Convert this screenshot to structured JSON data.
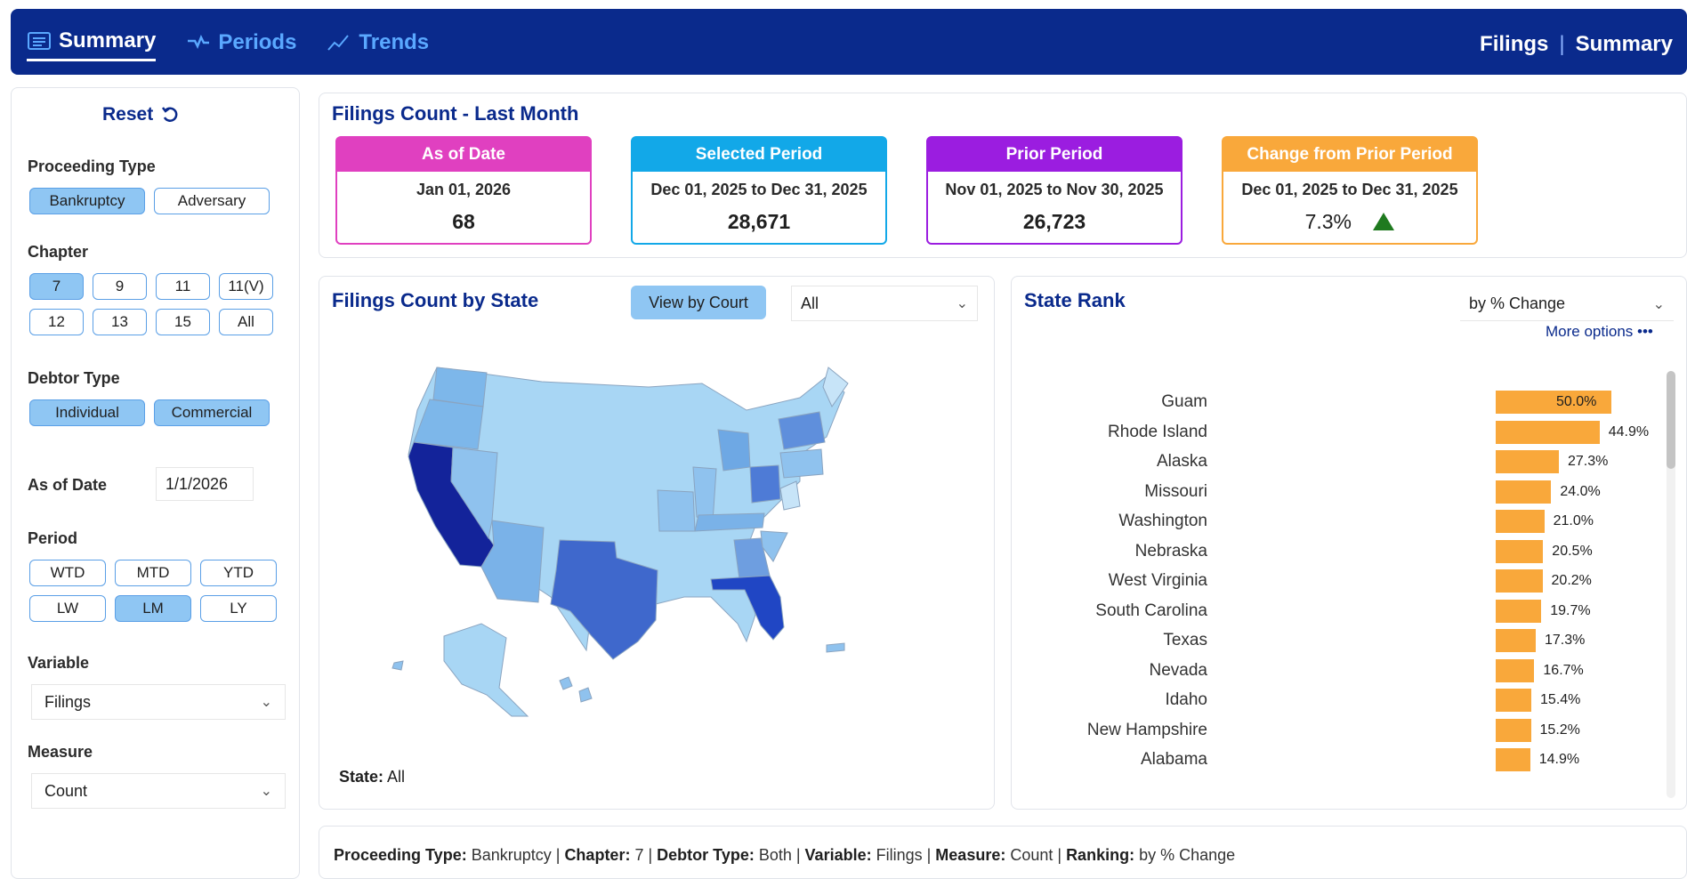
{
  "nav": {
    "tabs": [
      {
        "label": "Summary",
        "icon": "list-icon",
        "active": true
      },
      {
        "label": "Periods",
        "icon": "step-chart-icon",
        "active": false
      },
      {
        "label": "Trends",
        "icon": "trend-line-icon",
        "active": false
      }
    ],
    "breadcrumb": {
      "first": "Filings",
      "separator": "|",
      "second": "Summary"
    }
  },
  "filters": {
    "reset_label": "Reset",
    "proceeding_type": {
      "label": "Proceeding Type",
      "options": [
        "Bankruptcy",
        "Adversary"
      ],
      "selected": [
        "Bankruptcy"
      ]
    },
    "chapter": {
      "label": "Chapter",
      "options": [
        "7",
        "9",
        "11",
        "11(V)",
        "12",
        "13",
        "15",
        "All"
      ],
      "selected": [
        "7"
      ]
    },
    "debtor_type": {
      "label": "Debtor Type",
      "options": [
        "Individual",
        "Commercial"
      ],
      "selected": [
        "Individual",
        "Commercial"
      ]
    },
    "as_of_date": {
      "label": "As of Date",
      "value": "1/1/2026"
    },
    "period": {
      "label": "Period",
      "options": [
        "WTD",
        "MTD",
        "YTD",
        "LW",
        "LM",
        "LY"
      ],
      "selected": [
        "LM"
      ]
    },
    "variable": {
      "label": "Variable",
      "value": "Filings"
    },
    "measure": {
      "label": "Measure",
      "value": "Count"
    }
  },
  "kpi": {
    "title": "Filings Count - Last Month",
    "cards": [
      {
        "header": "As of Date",
        "sub": "Jan 01, 2026",
        "value": "68",
        "color": "#e040c0"
      },
      {
        "header": "Selected Period",
        "sub": "Dec 01, 2025 to Dec 31, 2025",
        "value": "28,671",
        "color": "#12a8e8"
      },
      {
        "header": "Prior Period",
        "sub": "Nov 01, 2025 to Nov 30, 2025",
        "value": "26,723",
        "color": "#9b1de0"
      },
      {
        "header": "Change from Prior Period",
        "sub": "Dec 01, 2025 to Dec 31, 2025",
        "value": "7.3%",
        "color": "#f9a83b",
        "trend": "up"
      }
    ]
  },
  "map": {
    "title": "Filings Count by State",
    "view_button": "View by Court",
    "court_filter": "All",
    "state_label": "State:",
    "state_value": "All"
  },
  "rank": {
    "title": "State Rank",
    "sort": "by % Change",
    "more_options": "More options •••",
    "bar_color": "#f9a83b"
  },
  "chart_data": {
    "type": "bar",
    "orientation": "horizontal",
    "categories": [
      "Guam",
      "Rhode Island",
      "Alaska",
      "Missouri",
      "Washington",
      "Nebraska",
      "West Virginia",
      "South Carolina",
      "Texas",
      "Nevada",
      "Idaho",
      "New Hampshire",
      "Alabama"
    ],
    "values": [
      50.0,
      44.9,
      27.3,
      24.0,
      21.0,
      20.5,
      20.2,
      19.7,
      17.3,
      16.7,
      15.4,
      15.2,
      14.9
    ],
    "value_labels": [
      "50.0%",
      "44.9%",
      "27.3%",
      "24.0%",
      "21.0%",
      "20.5%",
      "20.2%",
      "19.7%",
      "17.3%",
      "16.7%",
      "15.4%",
      "15.2%",
      "14.9%"
    ]
  },
  "footer": {
    "items": [
      {
        "key": "Proceeding Type:",
        "value": "Bankruptcy"
      },
      {
        "key": "Chapter:",
        "value": "7"
      },
      {
        "key": "Debtor Type:",
        "value": "Both"
      },
      {
        "key": "Variable:",
        "value": "Filings"
      },
      {
        "key": "Measure:",
        "value": "Count"
      },
      {
        "key": "Ranking:",
        "value": "by % Change"
      }
    ],
    "separator": " | "
  }
}
